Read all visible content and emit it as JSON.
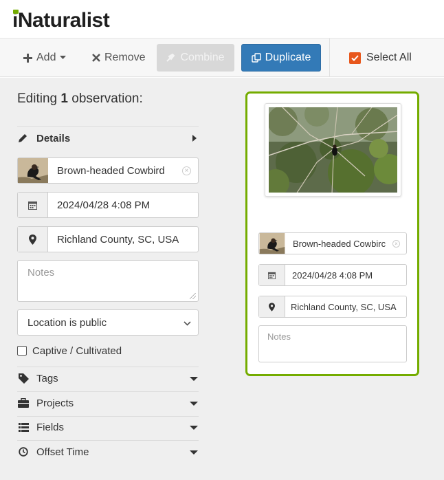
{
  "app": {
    "logo_text": "Naturalist",
    "logo_prefix": "i"
  },
  "toolbar": {
    "add_label": "Add",
    "remove_label": "Remove",
    "combine_label": "Combine",
    "duplicate_label": "Duplicate",
    "select_all_label": "Select All",
    "select_all_checked": true
  },
  "editor": {
    "editing_prefix": "Editing",
    "editing_count": "1",
    "editing_suffix": "observation:",
    "details_label": "Details",
    "taxon": "Brown-headed Cowbird",
    "datetime": "2024/04/28 4:08 PM",
    "location": "Richland County, SC, USA",
    "notes_placeholder": "Notes",
    "geoprivacy": "Location is public",
    "captive_label": "Captive / Cultivated",
    "captive_checked": false,
    "sections": [
      {
        "label": "Tags",
        "icon": "tag-icon"
      },
      {
        "label": "Projects",
        "icon": "briefcase-icon"
      },
      {
        "label": "Fields",
        "icon": "list-icon"
      },
      {
        "label": "Offset Time",
        "icon": "clock-icon"
      }
    ]
  },
  "card": {
    "taxon": "Brown-headed Cowbirc",
    "datetime": "2024/04/28 4:08 PM",
    "location": "Richland County, SC, USA",
    "notes_placeholder": "Notes",
    "selected": true,
    "border_color": "#74ac00"
  },
  "colors": {
    "accent": "#74ac00",
    "primary": "#337ab7",
    "checkbox": "#e8571c"
  }
}
